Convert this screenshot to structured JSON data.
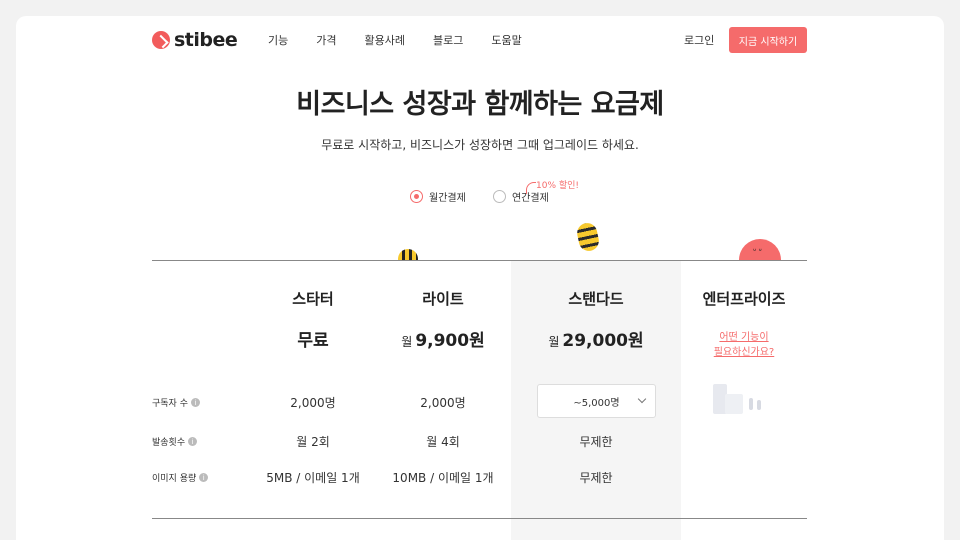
{
  "header": {
    "logo_text": "stibee",
    "nav": [
      "기능",
      "가격",
      "활용사례",
      "블로그",
      "도움말"
    ],
    "login": "로그인",
    "cta": "지금 시작하기"
  },
  "hero": {
    "title": "비즈니스 성장과 함께하는 요금제",
    "subtitle": "무료로 시작하고, 비즈니스가 성장하면 그때 업그레이드 하세요."
  },
  "billing": {
    "monthly": "월간결제",
    "yearly": "연간결제",
    "discount": "10% 할인!",
    "selected": "monthly"
  },
  "plans": [
    {
      "name": "스타터",
      "price": "무료",
      "subscribers": "2,000명",
      "sends": "월 2회",
      "image_storage": "5MB / 이메일 1개"
    },
    {
      "name": "라이트",
      "price_prefix": "월",
      "price": "9,900원",
      "subscribers": "2,000명",
      "sends": "월 4회",
      "image_storage": "10MB / 이메일 1개"
    },
    {
      "name": "스탠다드",
      "price_prefix": "월",
      "price": "29,000원",
      "subscribers_select": "~5,000명",
      "sends": "무제한",
      "image_storage": "무제한"
    },
    {
      "name": "엔터프라이즈",
      "link_line1": "어떤 기능이",
      "link_line2": "필요하신가요?"
    }
  ],
  "rows": {
    "subscribers": "구독자 수",
    "sends": "발송횟수",
    "image_storage": "이미지 용량"
  },
  "colors": {
    "accent": "#f56b6b",
    "bee_yellow": "#f7c92e",
    "standard_bg": "#f5f5f5"
  }
}
